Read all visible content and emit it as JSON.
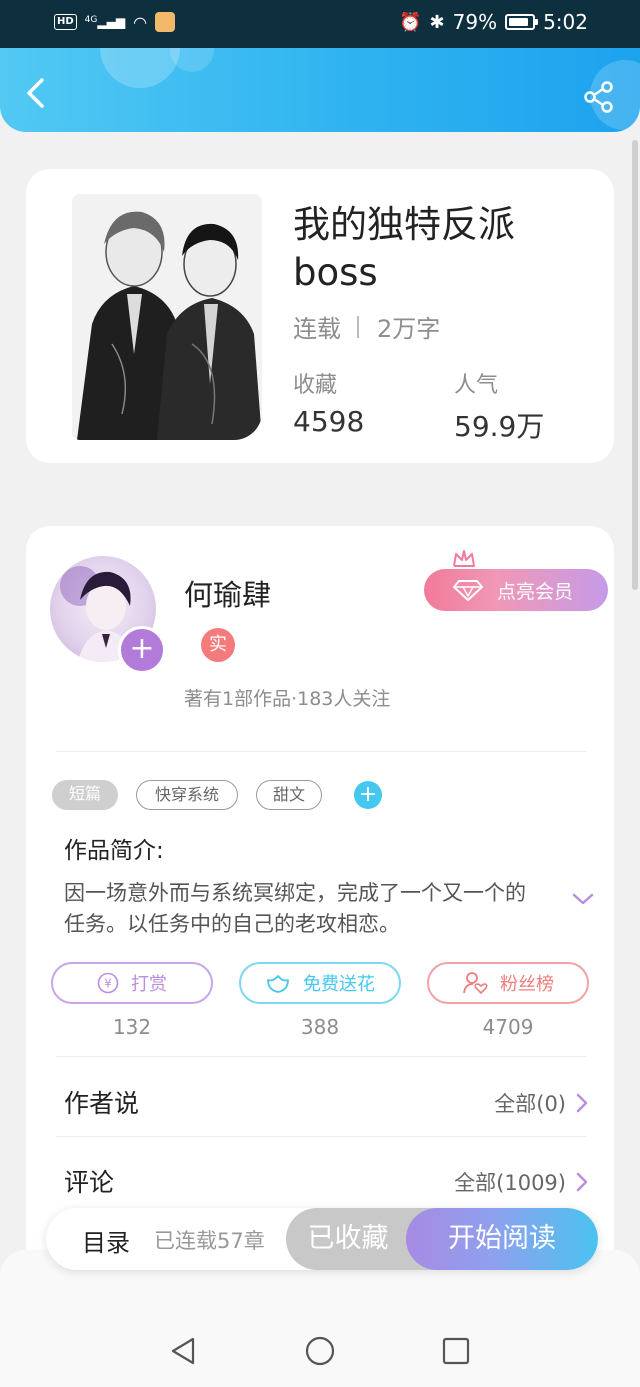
{
  "status_bar": {
    "network": "HD",
    "signal": "4G",
    "battery": "79%",
    "time": "5:02"
  },
  "book": {
    "title": "我的独特反派boss",
    "status": "连载",
    "word_count": "2万字",
    "favorites_label": "收藏",
    "favorites_value": "4598",
    "popularity_label": "人气",
    "popularity_value": "59.9万"
  },
  "author": {
    "name": "何瑜肆",
    "real_badge": "实",
    "info": "著有1部作品·183人关注",
    "vip_button": "点亮会员"
  },
  "tags": [
    "短篇",
    "快穿系统",
    "甜文"
  ],
  "intro": {
    "title": "作品简介:",
    "text": "因一场意外而与系统冥绑定，完成了一个又一个的任务。以任务中的自己的老攻相恋。"
  },
  "actions": [
    {
      "icon": "yen-icon",
      "label": "打赏",
      "count": "132",
      "color": "#b98ee0"
    },
    {
      "icon": "flower-icon",
      "label": "免费送花",
      "count": "388",
      "color": "#45c8ef"
    },
    {
      "icon": "fan-icon",
      "label": "粉丝榜",
      "count": "4709",
      "color": "#ef7d7d"
    }
  ],
  "rows": {
    "author_says_label": "作者说",
    "author_says_value": "全部(0)",
    "comments_label": "评论",
    "comments_value": "全部(1009)"
  },
  "read_bar": {
    "toc": "目录",
    "chapters": "已连载57章",
    "collected": "已收藏",
    "start": "开始阅读"
  }
}
